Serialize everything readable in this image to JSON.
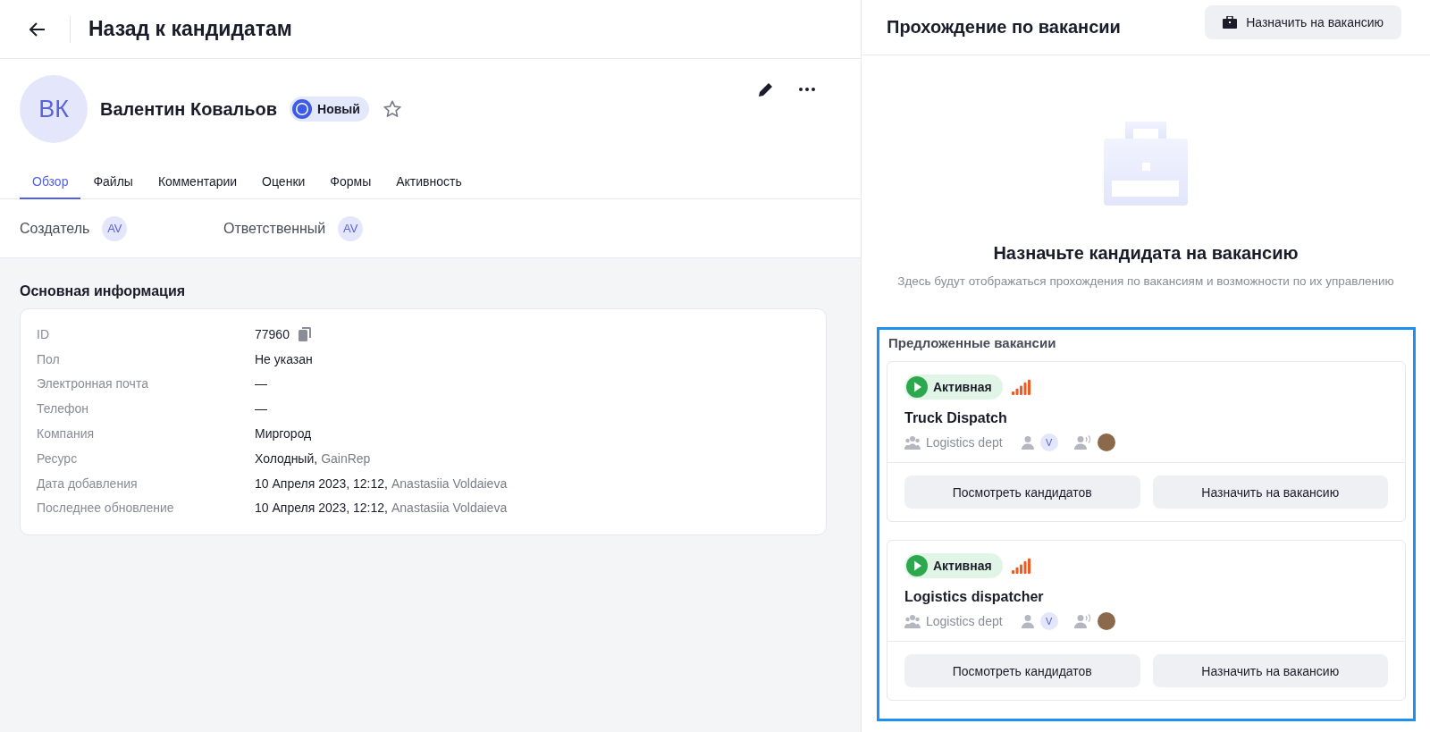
{
  "header": {
    "back_title": "Назад к кандидатам"
  },
  "candidate": {
    "initials": "ВК",
    "name": "Валентин Ковальов",
    "status": "Новый",
    "starred": false
  },
  "tabs": [
    {
      "label": "Обзор",
      "selected": true
    },
    {
      "label": "Файлы",
      "selected": false
    },
    {
      "label": "Комментарии",
      "selected": false
    },
    {
      "label": "Оценки",
      "selected": false
    },
    {
      "label": "Формы",
      "selected": false
    },
    {
      "label": "Активность",
      "selected": false
    }
  ],
  "people": [
    {
      "label": "Создатель",
      "initials": "AV"
    },
    {
      "label": "Ответственный",
      "initials": "AV"
    }
  ],
  "info": {
    "title": "Основная информация",
    "rows": [
      {
        "label": "ID",
        "value": "77960",
        "copyable": true
      },
      {
        "label": "Пол",
        "value": "Не указан",
        "copyable": false
      },
      {
        "label": "Электронная почта",
        "value": "—",
        "copyable": false
      },
      {
        "label": "Телефон",
        "value": "—",
        "copyable": false
      },
      {
        "label": "Компания",
        "value": "Миргород",
        "copyable": false
      },
      {
        "label": "Ресурс",
        "value": "Холодный,",
        "secondary": "GainRep",
        "copyable": false
      },
      {
        "label": "Дата добавления",
        "value": "10 Апреля 2023, 12:12,",
        "secondary": "Anastasiia Voldaieva",
        "copyable": false
      },
      {
        "label": "Последнее обновление",
        "value": "10 Апреля 2023, 12:12,",
        "secondary": "Anastasiia Voldaieva",
        "copyable": false
      }
    ]
  },
  "right": {
    "title": "Прохождение по вакансии",
    "assign_button": "Назначить на вакансию",
    "empty_title": "Назначьте кандидата на вакансию",
    "empty_text": "Здесь будут отображаться прохождения по вакансиям и возможности по их управлению",
    "suggested": {
      "title": "Предложенные вакансии",
      "vacancies": [
        {
          "status": "Активная",
          "title": "Truck Dispatch",
          "department": "Logistics dept",
          "recruiter_initials": "V",
          "buttons": [
            "Посмотреть кандидатов",
            "Назначить на вакансию"
          ]
        },
        {
          "status": "Активная",
          "title": "Logistics dispatcher",
          "department": "Logistics dept",
          "recruiter_initials": "V",
          "buttons": [
            "Посмотреть кандидатов",
            "Назначить на вакансию"
          ]
        }
      ]
    }
  }
}
